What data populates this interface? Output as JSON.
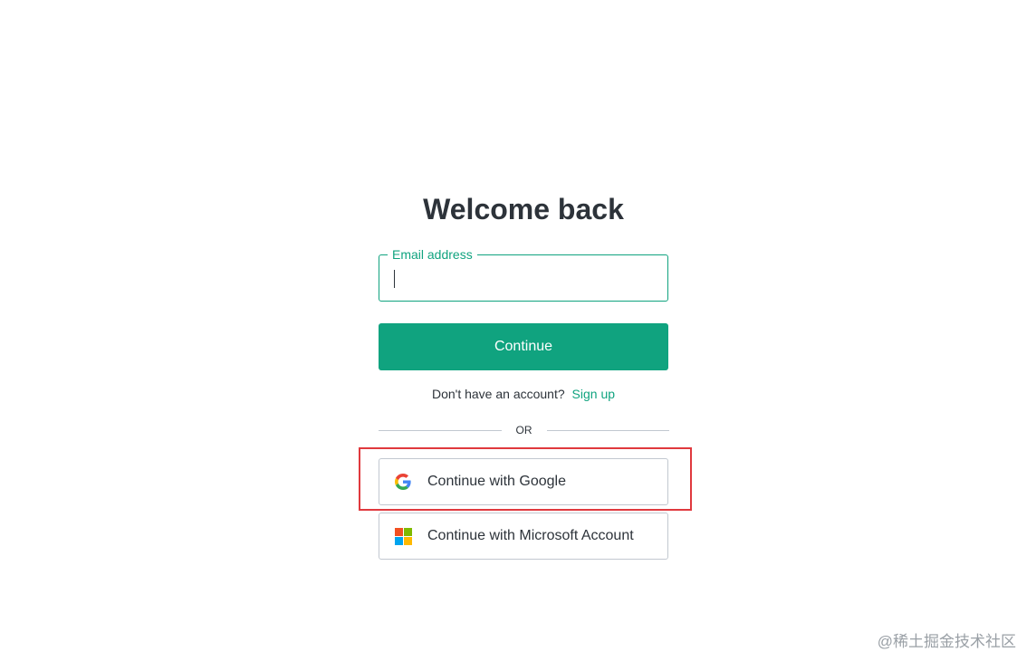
{
  "login": {
    "title": "Welcome back",
    "email_label": "Email address",
    "email_value": "",
    "continue_label": "Continue",
    "signup_prompt": "Don't have an account?",
    "signup_link": "Sign up",
    "divider_text": "OR"
  },
  "social": {
    "google_label": "Continue with Google",
    "google_icon": "google-g-icon",
    "microsoft_label": "Continue with Microsoft Account",
    "microsoft_icon": "microsoft-logo-icon"
  },
  "colors": {
    "accent": "#10a37f",
    "text": "#2d333a",
    "border": "#c2c8d0",
    "highlight": "#e0393e"
  },
  "watermark": "@稀土掘金技术社区"
}
